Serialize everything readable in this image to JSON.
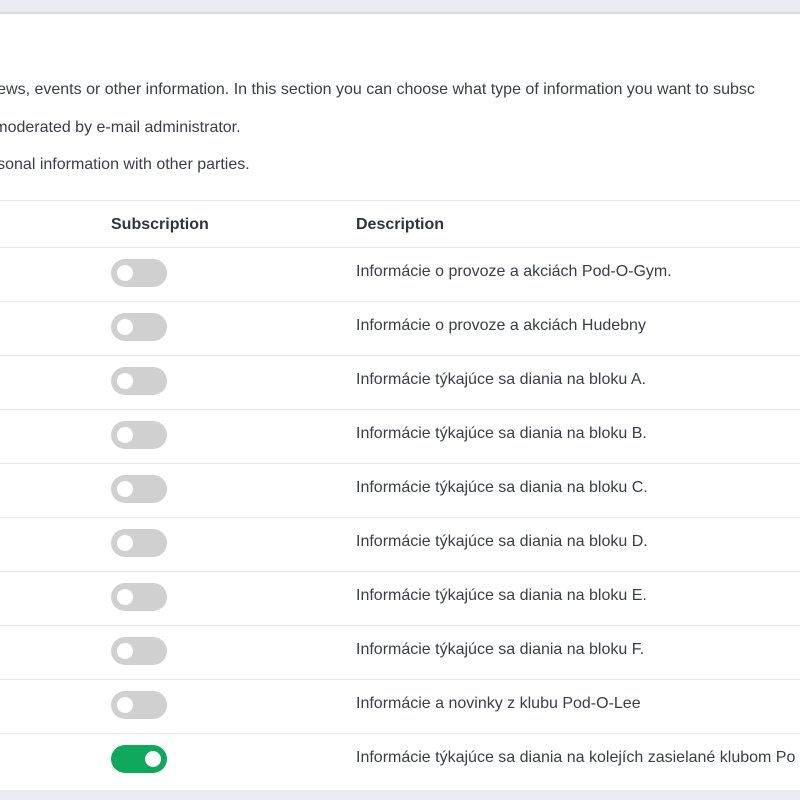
{
  "intro": {
    "line1": "ge news, events or other information. In this section you can choose what type of information you want to subsc",
    "line2": "nd moderated by e-mail administrator.",
    "line3": "personal information with other parties."
  },
  "table": {
    "headers": {
      "subscription": "Subscription",
      "description": "Description"
    },
    "rows": [
      {
        "description": "Informácie o provoze a akciách Pod-O-Gym.",
        "subscribed": false
      },
      {
        "description": "Informácie o provoze a akciách Hudebny",
        "subscribed": false
      },
      {
        "description": "Informácie týkajúce sa diania na bloku A.",
        "subscribed": false
      },
      {
        "description": "Informácie týkajúce sa diania na bloku B.",
        "subscribed": false
      },
      {
        "description": "Informácie týkajúce sa diania na bloku C.",
        "subscribed": false
      },
      {
        "description": "Informácie týkajúce sa diania na bloku D.",
        "subscribed": false
      },
      {
        "description": "Informácie týkajúce sa diania na bloku E.",
        "subscribed": false
      },
      {
        "description": "Informácie týkajúce sa diania na bloku F.",
        "subscribed": false
      },
      {
        "description": "Informácie a novinky z klubu Pod-O-Lee",
        "subscribed": false
      },
      {
        "description": "Informácie týkajúce sa diania na kolejích zasielané klubom Po",
        "subscribed": true
      }
    ]
  },
  "colors": {
    "toggle_off": "#d0d0d0",
    "toggle_on": "#0fa95c"
  }
}
